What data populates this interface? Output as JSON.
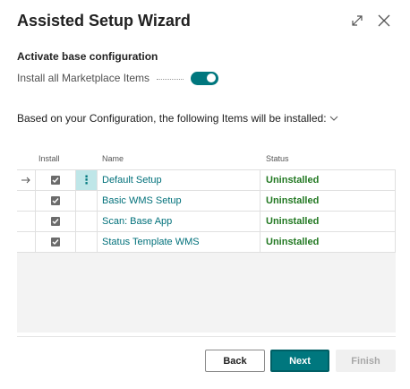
{
  "dialog": {
    "title": "Assisted Setup Wizard"
  },
  "section": {
    "title": "Activate base configuration",
    "toggle_label": "Install all Marketplace Items",
    "toggle_on": true
  },
  "config": {
    "text": "Based on your Configuration, the following Items will be installed:"
  },
  "table": {
    "columns": {
      "install": "Install",
      "name": "Name",
      "status": "Status"
    },
    "rows": [
      {
        "name": "Default Setup",
        "status": "Uninstalled",
        "installed": true,
        "active": true
      },
      {
        "name": "Basic WMS Setup",
        "status": "Uninstalled",
        "installed": true,
        "active": false
      },
      {
        "name": "Scan: Base App",
        "status": "Uninstalled",
        "installed": true,
        "active": false
      },
      {
        "name": "Status Template WMS",
        "status": "Uninstalled",
        "installed": true,
        "active": false
      }
    ]
  },
  "buttons": {
    "back": "Back",
    "next": "Next",
    "finish": "Finish"
  },
  "colors": {
    "accent": "#00777e",
    "status_ok": "#217821",
    "link": "#00707a"
  },
  "icons": {
    "expand": "expand-icon",
    "close": "close-icon",
    "chevron": "chevron-down-icon",
    "row_arrow": "arrow-right-icon",
    "checkmark": "checkmark-icon",
    "row_menu": "more-vertical-icon"
  }
}
